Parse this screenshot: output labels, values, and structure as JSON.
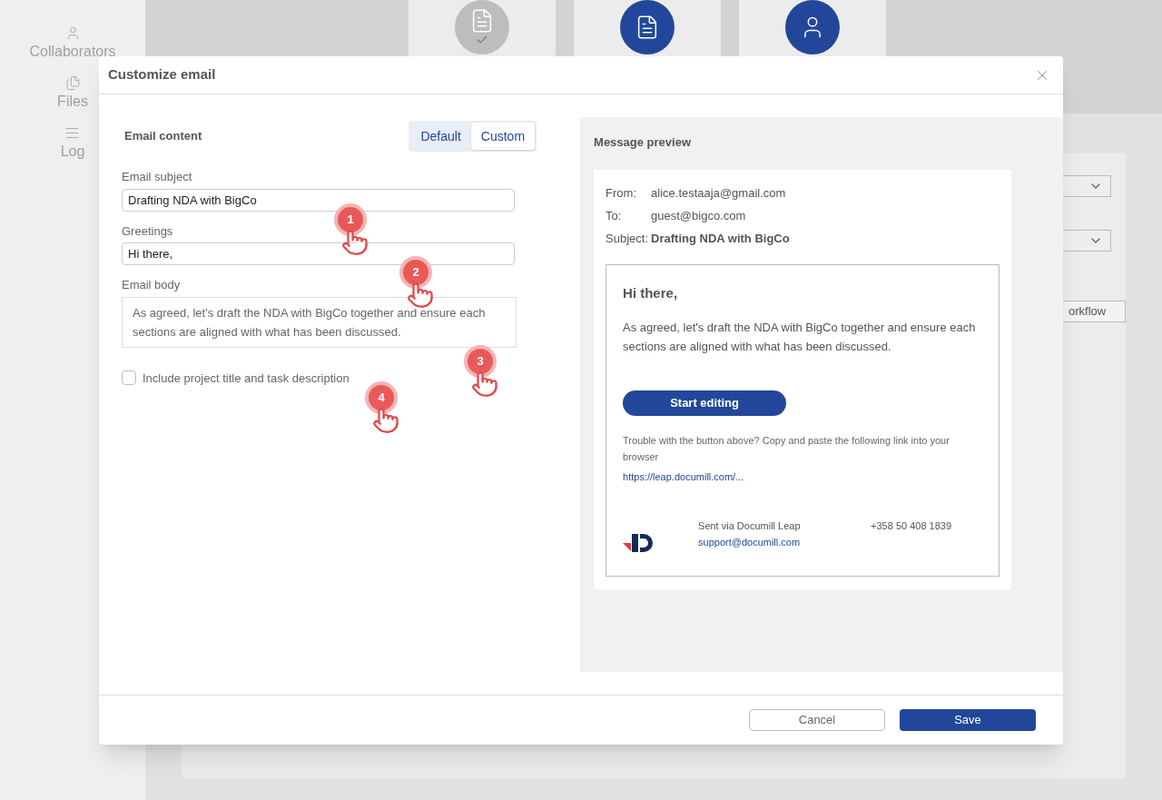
{
  "sidebar": {
    "items": [
      {
        "label": "Collaborators"
      },
      {
        "label": "Files"
      },
      {
        "label": "Log"
      }
    ]
  },
  "steps": [
    {
      "completed": true
    },
    {
      "completed": false
    },
    {
      "completed": false
    }
  ],
  "workflow_button": {
    "label": "orkflow"
  },
  "dialog": {
    "title": "Customize email",
    "content_label": "Email content",
    "content_options": [
      {
        "label": "Default",
        "selected": false
      },
      {
        "label": "Custom",
        "selected": true
      }
    ],
    "subject": {
      "label": "Email subject",
      "value": "Drafting NDA with BigCo"
    },
    "greetings": {
      "label": "Greetings",
      "value": "Hi there,"
    },
    "body": {
      "label": "Email body",
      "value": "As agreed, let's draft the NDA with BigCo together and ensure each sections are aligned with what has been discussed."
    },
    "include_checkbox": {
      "label": "Include project title and task description",
      "checked": false
    },
    "preview": {
      "title": "Message preview",
      "headers": [
        {
          "label": "From:",
          "value": "alice.testaaja@gmail.com",
          "bold": false
        },
        {
          "label": "To:",
          "value": "guest@bigco.com",
          "bold": false
        },
        {
          "label": "Subject:",
          "value": "Drafting NDA with BigCo",
          "bold": true
        }
      ],
      "greeting": "Hi there,",
      "body": "As agreed, let's draft the NDA with BigCo together and ensure each sections are aligned with what has been discussed.",
      "button": "Start editing",
      "trouble_text": "Trouble with the button above? Copy and paste the following link into your browser",
      "link": "https://leap.documill.com/...",
      "sent_via": "Sent via Documill Leap",
      "support_email": "support@documill.com",
      "phone": "+358 50 408 1839"
    },
    "buttons": {
      "cancel": "Cancel",
      "save": "Save"
    }
  },
  "callouts": [
    {
      "number": "1"
    },
    {
      "number": "2"
    },
    {
      "number": "3"
    },
    {
      "number": "4"
    }
  ]
}
